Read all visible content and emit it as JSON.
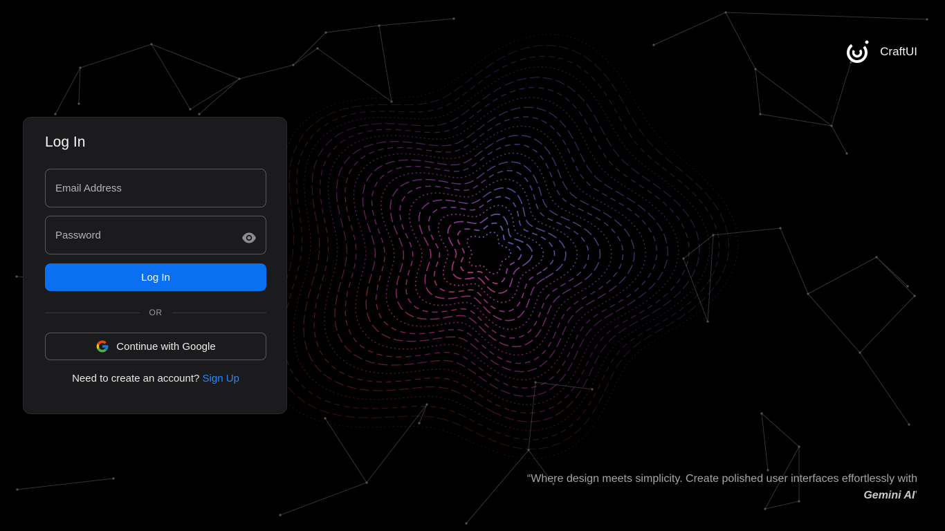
{
  "brand": {
    "name": "CraftUI",
    "logo_icon": "craftui-logo-icon"
  },
  "login_card": {
    "title": "Log In",
    "email_placeholder": "Email Address",
    "password_placeholder": "Password",
    "show_password_icon": "eye-icon",
    "submit_label": "Log In",
    "divider_text": "OR",
    "google_label": "Continue with Google",
    "google_icon": "google-icon",
    "signup_prompt": "Need to create an account?",
    "signup_link": "Sign Up"
  },
  "quote": {
    "prefix": "“Where design meets simplicity. Create polished user interfaces effortlessly with ",
    "highlight": "Gemini AI",
    "suffix": "’"
  },
  "colors": {
    "background": "#000000",
    "card": "#1b1b1d",
    "primary": "#0a6ff0",
    "link": "#2f86f5"
  }
}
